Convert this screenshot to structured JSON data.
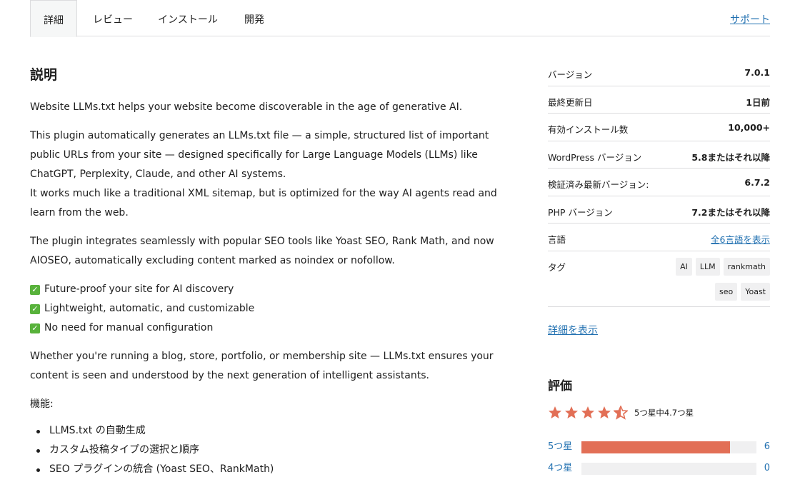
{
  "tabs": {
    "items": [
      "詳細",
      "レビュー",
      "インストール",
      "開発"
    ],
    "support": "サポート"
  },
  "main": {
    "title": "説明",
    "p1": "Website LLMs.txt helps your website become discoverable in the age of generative AI.",
    "p2a": "This plugin automatically generates an LLMs.txt file — a simple, structured list of important public URLs from your site — designed specifically for Large Language Models (LLMs) like ChatGPT, Perplexity, Claude, and other AI systems.",
    "p2b": "It works much like a traditional XML sitemap, but is optimized for the way AI agents read and learn from the web.",
    "p3": "The plugin integrates seamlessly with popular SEO tools like Yoast SEO, Rank Math, and now AIOSEO, automatically excluding content marked as noindex or nofollow.",
    "checks": [
      "Future-proof your site for AI discovery",
      "Lightweight, automatic, and customizable",
      "No need for manual configuration"
    ],
    "p4": "Whether you're running a blog, store, portfolio, or membership site — LLMs.txt ensures your content is seen and understood by the next generation of intelligent assistants.",
    "features_label": "機能:",
    "features": [
      "LLMS.txt の自動生成",
      "カスタム投稿タイプの選択と順序",
      "SEO プラグインの統合 (Yoast SEO、RankMath)"
    ]
  },
  "meta": {
    "version_label": "バージョン",
    "version": "7.0.1",
    "updated_label": "最終更新日",
    "updated": "1日前",
    "installs_label": "有効インストール数",
    "installs": "10,000+",
    "wp_label": "WordPress バージョン",
    "wp": "5.8またはそれ以降",
    "tested_label": "検証済み最新バージョン:",
    "tested": "6.7.2",
    "php_label": "PHP バージョン",
    "php": "7.2またはそれ以降",
    "lang_label": "言語",
    "lang_link": "全6言語を表示",
    "tags_label": "タグ",
    "tags": [
      "AI",
      "LLM",
      "rankmath",
      "seo",
      "Yoast"
    ],
    "more_details": "詳細を表示"
  },
  "ratings": {
    "title": "評価",
    "summary": "5つ星中4.7つ星",
    "stars_value": 4.7,
    "star_color": "#e26f56",
    "bars": [
      {
        "label": "5つ星",
        "count": "6",
        "fraction": 0.85
      },
      {
        "label": "4つ星",
        "count": "0",
        "fraction": 0
      }
    ]
  }
}
